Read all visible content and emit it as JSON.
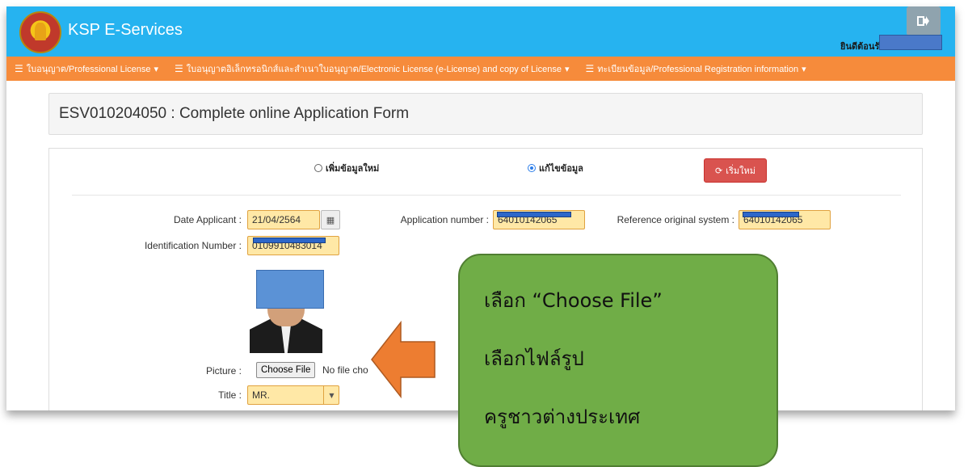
{
  "header": {
    "brand": "KSP E-Services",
    "welcome_label": "ยินดีต้อนรั"
  },
  "nav": {
    "items": [
      {
        "label": "ใบอนุญาต/Professional License"
      },
      {
        "label": "ใบอนุญาตอิเล็กทรอนิกส์และสำเนาใบอนุญาต/Electronic License (e-License) and copy of License"
      },
      {
        "label": "ทะเบียนข้อมูล/Professional Registration information"
      }
    ]
  },
  "page": {
    "title": "ESV010204050 : Complete online Application Form"
  },
  "form": {
    "radio_new_label": "เพิ่มข้อมูลใหม่",
    "radio_edit_label": "แก้ไขข้อมูล",
    "radio_selected": "edit",
    "reset_label": "เริ่มใหม่",
    "date_applicant_label": "Date Applicant :",
    "date_applicant_value": "21/04/2564",
    "application_number_label": "Application number :",
    "application_number_value": "64010142065",
    "reference_label": "Reference original system :",
    "reference_value": "64010142065",
    "id_number_label": "Identification Number :",
    "id_number_value": "0109910483014",
    "picture_label": "Picture :",
    "choose_file_label": "Choose File",
    "no_file_text": "No file cho",
    "title_label": "Title :",
    "title_value": "MR."
  },
  "annotation": {
    "line1": "เลือก “Choose File”",
    "line2": "เลือกไฟล์รูป",
    "line3": "ครูชาวต่างประเทศ",
    "callout_color": "#70ad47",
    "arrow_color": "#ed7d31"
  },
  "colors": {
    "topbar": "#26b3f0",
    "navbar": "#f68b3b",
    "field_bg": "#ffe8a6",
    "reset_button": "#d9534f",
    "redaction": "#2d67c9"
  }
}
